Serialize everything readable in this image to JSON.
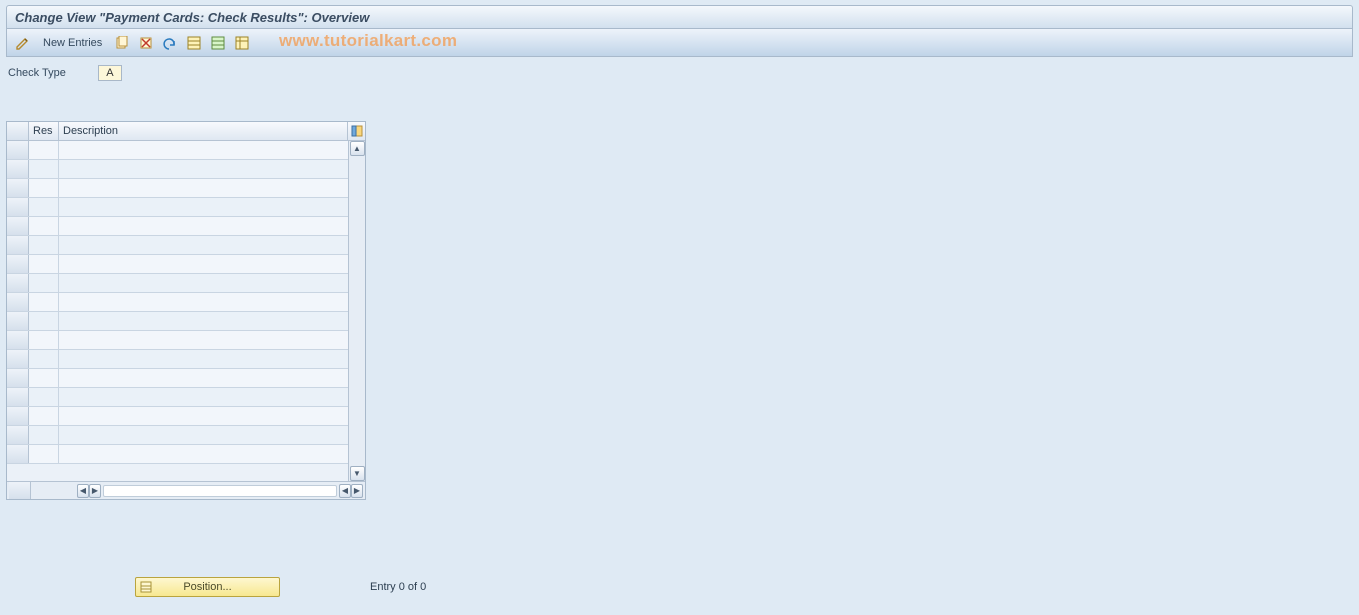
{
  "title": "Change View \"Payment Cards: Check Results\": Overview",
  "toolbar": {
    "new_entries": "New Entries"
  },
  "watermark": "www.tutorialkart.com",
  "field": {
    "label": "Check Type",
    "value": "A"
  },
  "table": {
    "col_res": "Res",
    "col_desc": "Description",
    "row_count": 17
  },
  "footer": {
    "position_label": "Position...",
    "entry_text": "Entry 0 of 0"
  }
}
